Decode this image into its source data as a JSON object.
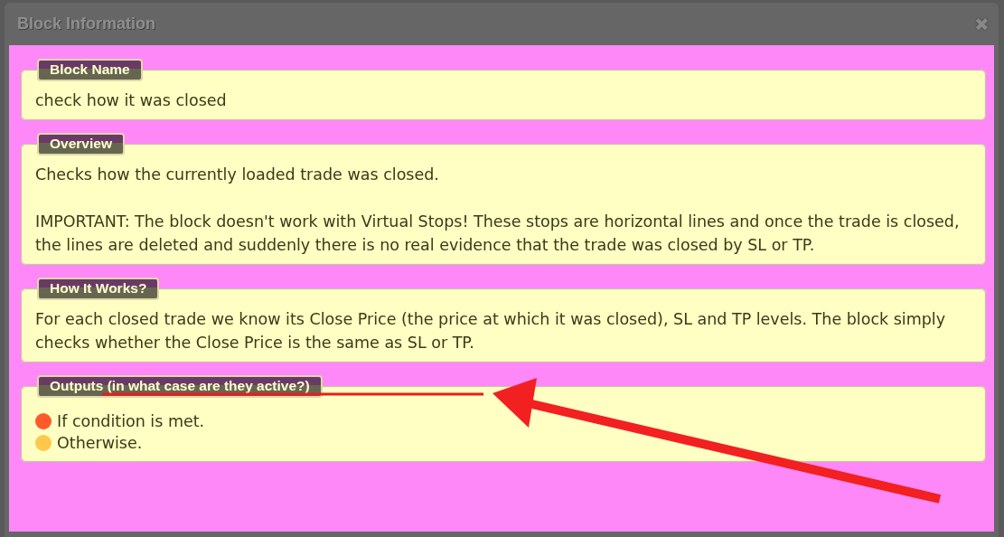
{
  "window": {
    "title": "Block Information",
    "close": "✖"
  },
  "sections": [
    {
      "kind": "text",
      "legend": "Block Name",
      "paragraphs": [
        "check how it was closed"
      ]
    },
    {
      "kind": "text",
      "legend": "Overview",
      "paragraphs": [
        "Checks how the currently loaded trade was closed.",
        "IMPORTANT: The block doesn't work with Virtual Stops! These stops are horizontal lines and once the trade is closed, the lines are deleted and suddenly there is no real evidence that the trade was closed by SL or TP."
      ]
    },
    {
      "kind": "text",
      "legend": "How It Works?",
      "paragraphs": [
        "For each closed trade we know its Close Price (the price at which it was closed), SL and TP levels. The block simply checks whether the Close Price is the same as SL or TP."
      ]
    },
    {
      "kind": "outputs",
      "legend": "Outputs (in what case are they active?)",
      "items": [
        {
          "label": "If condition is met.",
          "color": "#ff5a2a"
        },
        {
          "label": "Otherwise.",
          "color": "#ffc84a"
        }
      ]
    }
  ]
}
